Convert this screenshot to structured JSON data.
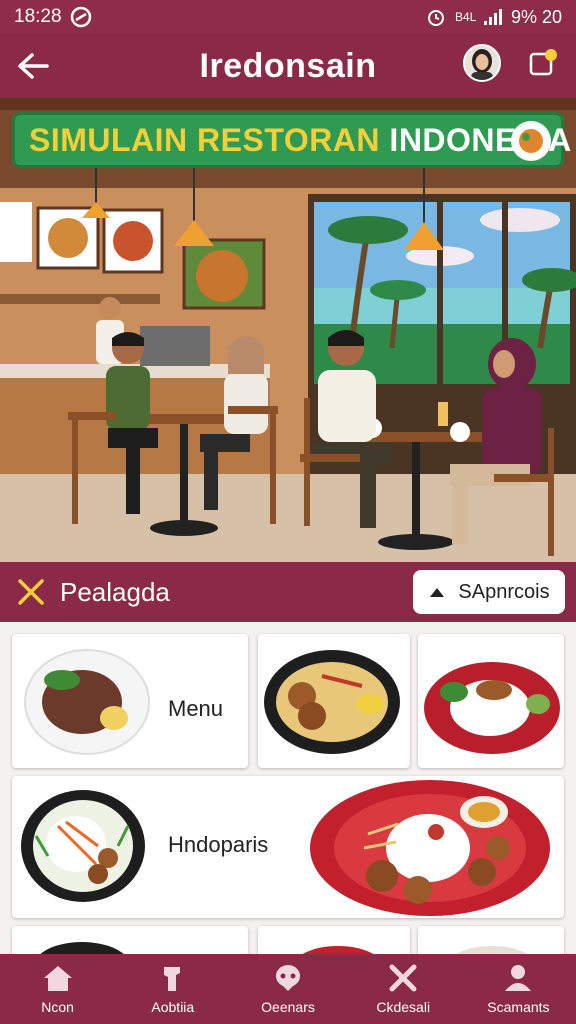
{
  "status_bar": {
    "time": "18:28",
    "network": "B4L",
    "battery": "9% 20"
  },
  "app_bar": {
    "title": "Iredonsain"
  },
  "hero": {
    "banner_part1": "SIMULAIN RESTORAN",
    "banner_part2": "INDONESIA"
  },
  "section": {
    "title": "Pealagda",
    "button_label": "SApnrcois"
  },
  "grid": {
    "card1_label": "Menu",
    "card4_label": "Hndoparis"
  },
  "nav": {
    "items": [
      {
        "label": "Ncon",
        "icon": "home-icon"
      },
      {
        "label": "Aobtiia",
        "icon": "chef-icon"
      },
      {
        "label": "Oeenars",
        "icon": "guest-icon"
      },
      {
        "label": "Ckdesali",
        "icon": "utensils-icon"
      },
      {
        "label": "Scamants",
        "icon": "staff-icon"
      }
    ]
  },
  "colors": {
    "brand": "#8a2a48",
    "banner_green": "#2f9a52",
    "banner_yellow": "#f5cf3a"
  }
}
